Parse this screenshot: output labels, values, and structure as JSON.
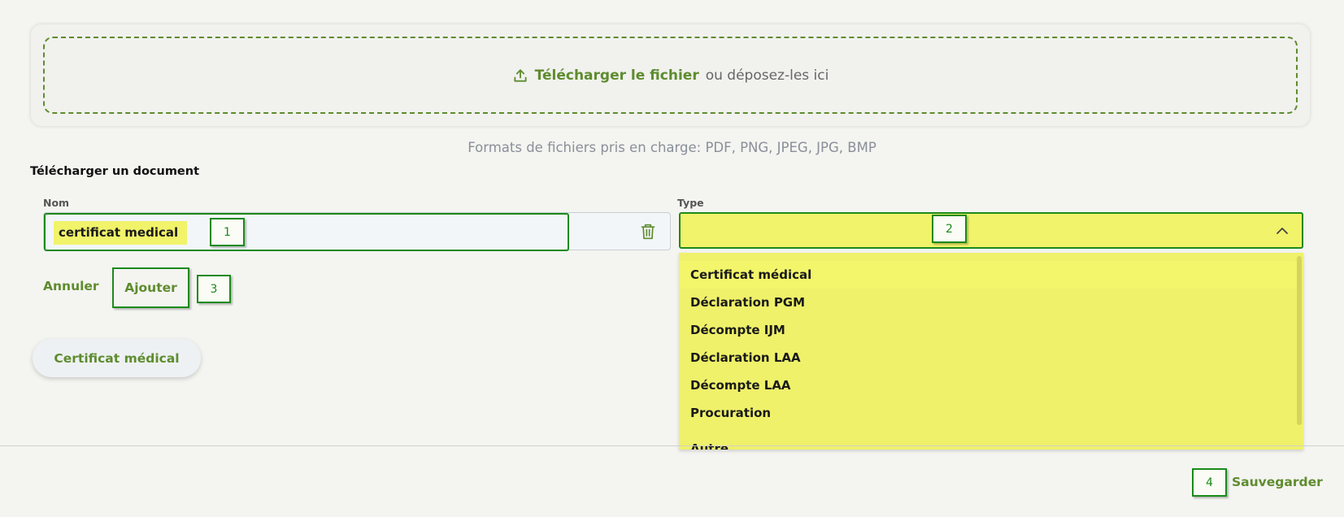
{
  "upload": {
    "link_label": "Télécharger le fichier",
    "drop_label": "ou déposez-les ici",
    "formats": "Formats de fichiers pris en charge: PDF, PNG, JPEG, JPG, BMP"
  },
  "section_title": "Télécharger un document",
  "name_field": {
    "label": "Nom",
    "value": "certificat medical"
  },
  "type_field": {
    "label": "Type",
    "value": "",
    "options": [
      "Certificat médical",
      "Déclaration PGM",
      "Décompte IJM",
      "Déclaration LAA",
      "Décompte LAA",
      "Procuration",
      "Autre"
    ]
  },
  "actions": {
    "cancel_label": "Annuler",
    "add_label": "Ajouter",
    "save_label": "Sauvegarder"
  },
  "chips": [
    "Certificat médical"
  ],
  "badges": {
    "b1": "1",
    "b2": "2",
    "b3": "3",
    "b4": "4"
  },
  "icons": {
    "upload": "upload-icon",
    "trash": "trash-icon",
    "chevron": "chevron-up-icon"
  },
  "colors": {
    "accent": "#5e8c2e",
    "highlight": "#f1f36a",
    "annotation": "#1b8a1b"
  }
}
